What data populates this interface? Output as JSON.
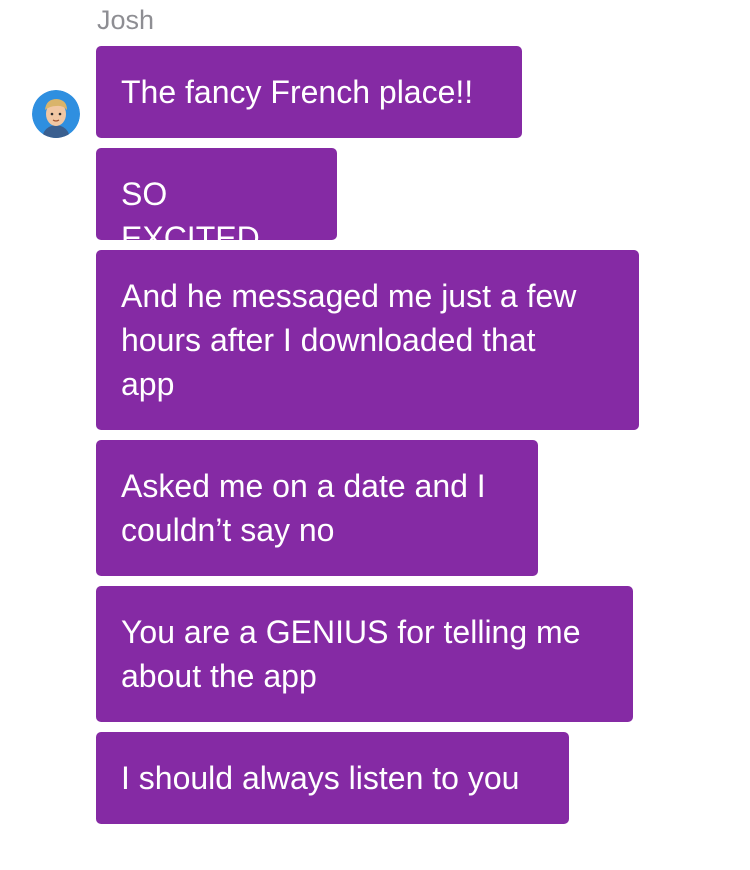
{
  "conversation": {
    "sender_name": "Josh",
    "avatar_icon": "user-avatar-icon",
    "bubble_color": "#852aa4",
    "messages": [
      {
        "text": "The fancy French place!!"
      },
      {
        "text": "SO EXCITED"
      },
      {
        "text": "And he messaged me just a few\nhours after I downloaded that\napp"
      },
      {
        "text": "Asked me on a date and I\ncouldn’t say no"
      },
      {
        "text": "You are a GENIUS for telling me\nabout the app"
      },
      {
        "text": "I should always listen to you"
      }
    ]
  }
}
